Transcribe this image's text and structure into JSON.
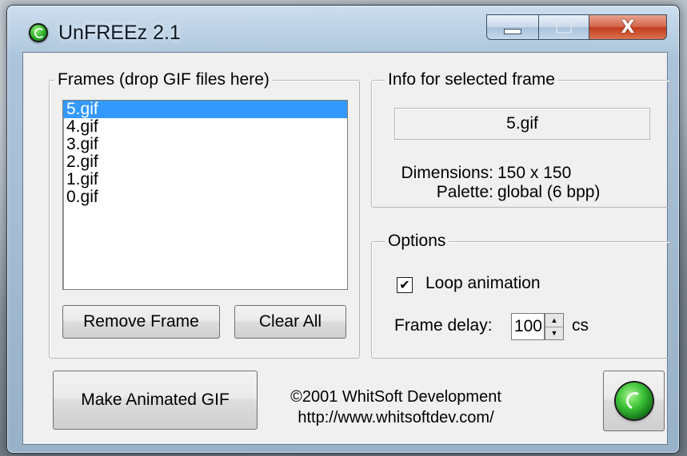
{
  "window": {
    "title": "UnFREEz 2.1"
  },
  "frames_group": {
    "title": "Frames (drop GIF files here)",
    "items": [
      "5.gif",
      "4.gif",
      "3.gif",
      "2.gif",
      "1.gif",
      "0.gif"
    ],
    "selected": "5.gif",
    "remove_label": "Remove Frame",
    "clear_label": "Clear All"
  },
  "info_group": {
    "title": "Info for selected frame",
    "filename": "5.gif",
    "dimensions_label": "Dimensions:",
    "dimensions_value": "150 x 150",
    "palette_label": "Palette:",
    "palette_value": "global (6 bpp)"
  },
  "options_group": {
    "title": "Options",
    "loop_label": "Loop animation",
    "loop_checked": true,
    "delay_label": "Frame delay:",
    "delay_value": "100",
    "delay_unit": "cs"
  },
  "footer": {
    "make_label": "Make Animated GIF",
    "copyright_line1": "©2001 WhitSoft Development",
    "copyright_line2": "http://www.whitsoftdev.com/"
  },
  "icons": {
    "app": "green-swirl-icon",
    "logo": "green-swirl-logo-icon",
    "minimize": "minimize-icon",
    "maximize": "maximize-icon",
    "close": "close-icon",
    "checkmark": "checkmark-icon",
    "spin_up": "spin-up-icon",
    "spin_down": "spin-down-icon"
  },
  "colors": {
    "selection": "#3399ff",
    "close_button": "#c23a1d",
    "logo_green": "#3cc236"
  }
}
